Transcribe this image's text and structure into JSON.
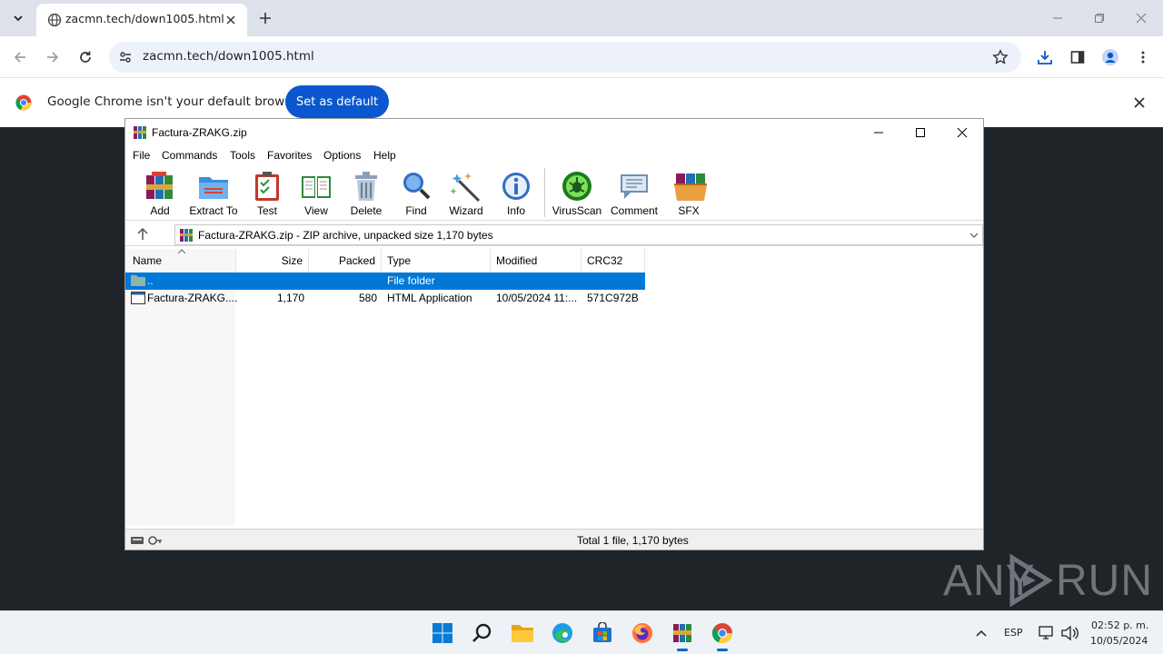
{
  "browser": {
    "tab": {
      "title": "zacmn.tech/down1005.html"
    },
    "address": {
      "url": "zacmn.tech/down1005.html"
    },
    "infobar": {
      "message": "Google Chrome isn't your default browser",
      "button": "Set as default"
    },
    "accent_color": "#0b57d0"
  },
  "winrar": {
    "title": "Factura-ZRAKG.zip",
    "menu": [
      "File",
      "Commands",
      "Tools",
      "Favorites",
      "Options",
      "Help"
    ],
    "toolbar": [
      "Add",
      "Extract To",
      "Test",
      "View",
      "Delete",
      "Find",
      "Wizard",
      "Info",
      "VirusScan",
      "Comment",
      "SFX"
    ],
    "path": "Factura-ZRAKG.zip - ZIP archive, unpacked size 1,170 bytes",
    "columns": [
      "Name",
      "Size",
      "Packed",
      "Type",
      "Modified",
      "CRC32"
    ],
    "rows": [
      {
        "name": "..",
        "size": "",
        "packed": "",
        "type": "File folder",
        "modified": "",
        "crc": ""
      },
      {
        "name": "Factura-ZRAKG....",
        "size": "1,170",
        "packed": "580",
        "type": "HTML Application",
        "modified": "10/05/2024 11:...",
        "crc": "571C972B"
      }
    ],
    "status": "Total 1 file, 1,170 bytes",
    "selection_color": "#0078d7"
  },
  "watermark": {
    "left": "ANY",
    "right": "RUN"
  },
  "taskbar": {
    "language": "ESP",
    "time": "02:52 p. m.",
    "date": "10/05/2024"
  }
}
